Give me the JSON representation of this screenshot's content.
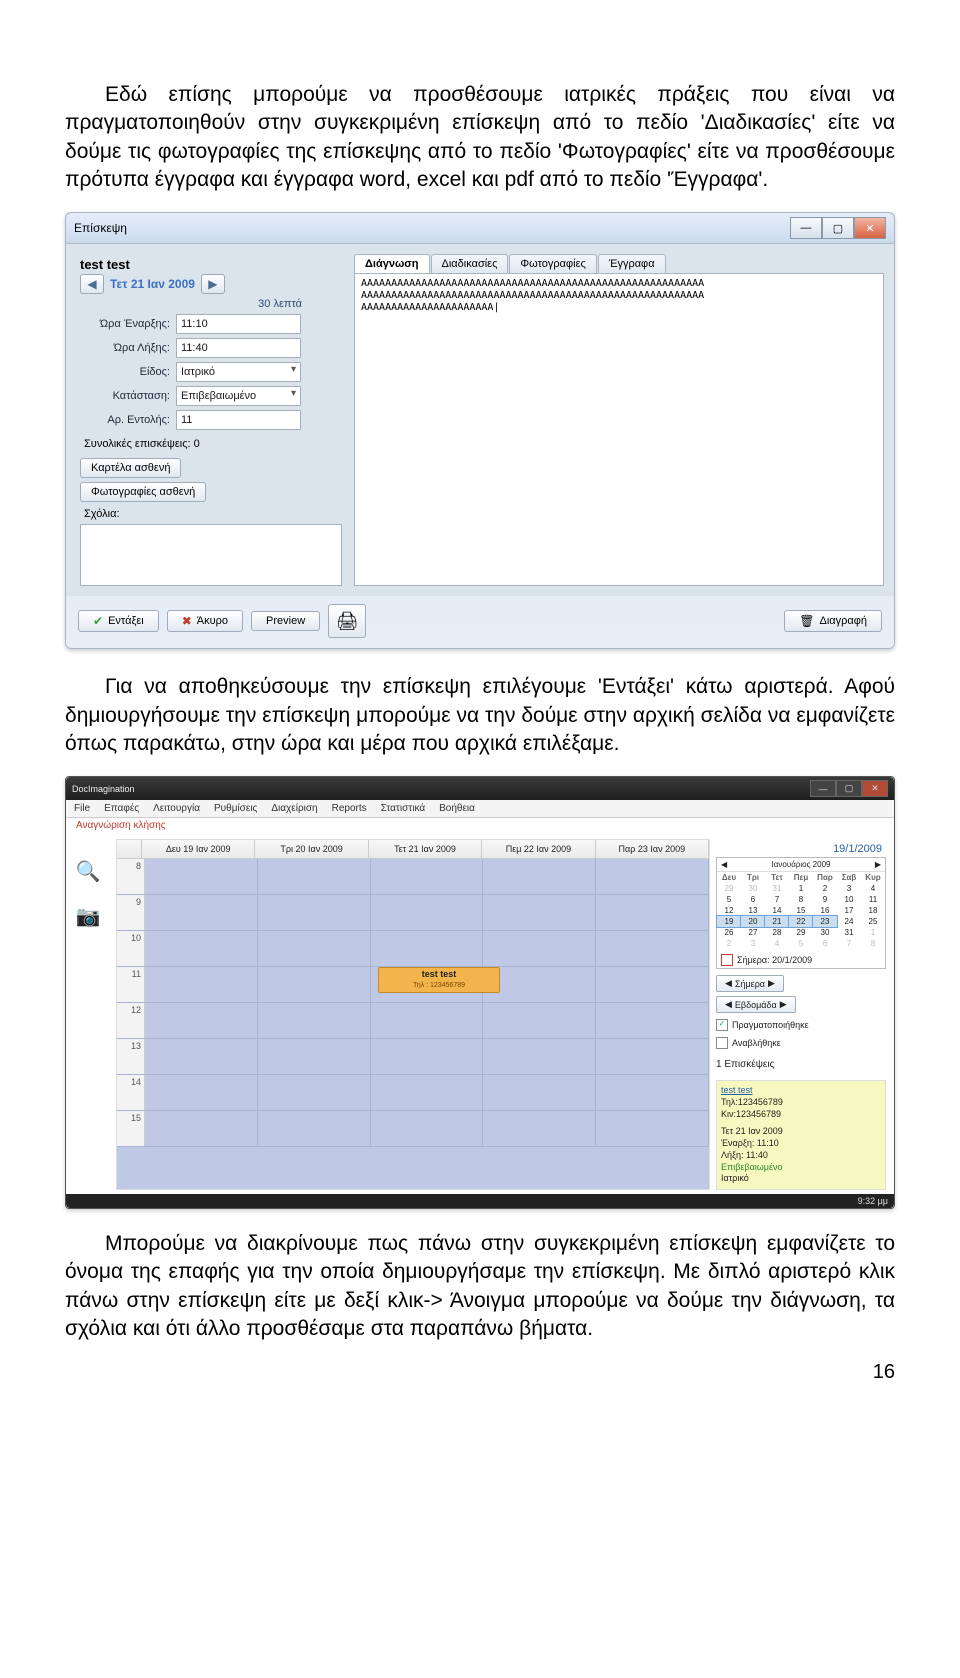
{
  "paragraph1": "Εδώ επίσης μπορούμε να προσθέσουμε ιατρικές πράξεις που είναι να πραγματοποιηθούν στην συγκεκριμένη επίσκεψη από το πεδίο 'Διαδικασίες' είτε να δούμε τις φωτογραφίες της επίσκεψης από το πεδίο 'Φωτογραφίες' είτε να προσθέσουμε πρότυπα έγγραφα και έγγραφα word, excel και pdf από το πεδίο 'Έγγραφα'.",
  "paragraph2": "Για να αποθηκεύσουμε την επίσκεψη επιλέγουμε 'Εντάξει' κάτω αριστερά. Αφού δημιουργήσουμε την επίσκεψη μπορούμε να την δούμε στην αρχική σελίδα να εμφανίζετε όπως παρακάτω, στην ώρα και μέρα που αρχικά επιλέξαμε.",
  "paragraph3": "Μπορούμε να διακρίνουμε πως πάνω στην συγκεκριμένη επίσκεψη εμφανίζετε το όνομα της επαφής για την οποία δημιουργήσαμε την επίσκεψη. Με διπλό αριστερό κλικ πάνω στην επίσκεψη είτε με δεξί κλικ-> Άνοιγμα μπορούμε να δούμε την διάγνωση, τα σχόλια και ότι άλλο προσθέσαμε στα παραπάνω βήματα.",
  "page_number": "16",
  "win1": {
    "title": "Επίσκεψη",
    "patient": "test test",
    "date": "Τετ 21 Ιαν 2009",
    "duration": "30 λεπτά",
    "labels": {
      "start": "Ώρα Έναρξης:",
      "end": "Ώρα Λήξης:",
      "kind": "Είδος:",
      "status": "Κατάσταση:",
      "orderno": "Αρ. Εντολής:",
      "totalvisits": "Συνολικές επισκέψεις: 0",
      "comments": "Σχόλια:"
    },
    "values": {
      "start": "11:10",
      "end": "11:40",
      "kind": "Ιατρικό",
      "status": "Επιβεβαιωμένο",
      "orderno": "11"
    },
    "buttons": {
      "card": "Καρτέλα ασθενή",
      "photos": "Φωτογραφίες ασθενή",
      "ok": "Εντάξει",
      "cancel": "Άκυρο",
      "preview": "Preview",
      "delete": "Διαγραφή"
    },
    "tabs": {
      "diag": "Διάγνωση",
      "proc": "Διαδικασίες",
      "photos": "Φωτογραφίες",
      "docs": "Έγγραφα"
    },
    "diag_body": "ΑΑΑΑΑΑΑΑΑΑΑΑΑΑΑΑΑΑΑΑΑΑΑΑΑΑΑΑΑΑΑΑΑΑΑΑΑΑΑΑΑΑΑΑΑΑΑΑΑΑΑΑΑΑΑΑΑ\nΑΑΑΑΑΑΑΑΑΑΑΑΑΑΑΑΑΑΑΑΑΑΑΑΑΑΑΑΑΑΑΑΑΑΑΑΑΑΑΑΑΑΑΑΑΑΑΑΑΑΑΑΑΑΑΑΑ\nΑΑΑΑΑΑΑΑΑΑΑΑΑΑΑΑΑΑΑΑΑΑ|"
  },
  "win2": {
    "app": "DocImagination",
    "menu": [
      "File",
      "Επαφές",
      "Λειτουργία",
      "Ρυθμίσεις",
      "Διαχείριση",
      "Reports",
      "Στατιστικά",
      "Βοήθεια"
    ],
    "redline": "Αναγνώριση κλήσης",
    "datepicker": "19/1/2009",
    "days": [
      "Δευ 19 Ιαν 2009",
      "Τρι 20 Ιαν 2009",
      "Τετ 21 Ιαν 2009",
      "Πεμ 22 Ιαν 2009",
      "Παρ 23 Ιαν 2009"
    ],
    "hours": [
      "8",
      "9",
      "10",
      "11",
      "12",
      "13",
      "14",
      "15"
    ],
    "appt_name": "test test",
    "appt_tel": "Τηλ : 123456789",
    "minical": {
      "month": "Ιανουάριος 2009",
      "dow": [
        "Δευ",
        "Τρι",
        "Τετ",
        "Πεμ",
        "Παρ",
        "Σαβ",
        "Κυρ"
      ],
      "lead": [
        "29",
        "30",
        "31"
      ],
      "days": [
        "1",
        "2",
        "3",
        "4",
        "5",
        "6",
        "7",
        "8",
        "9",
        "10",
        "11",
        "12",
        "13",
        "14",
        "15",
        "16",
        "17",
        "18",
        "19",
        "20",
        "21",
        "22",
        "23",
        "24",
        "25",
        "26",
        "27",
        "28",
        "29",
        "30",
        "31"
      ],
      "trail": [
        "1",
        "2",
        "3",
        "4",
        "5",
        "6",
        "7",
        "8"
      ],
      "selected_from": 19,
      "selected_to": 23,
      "today_label": "Σήμερα: 20/1/2009"
    },
    "nav": {
      "today": "Σήμερα",
      "week": "Εβδομάδα",
      "done_chk": "Πραγματοποιήθηκε",
      "postponed": "Αναβλήθηκε"
    },
    "right_info": {
      "count": "1 Επισκέψεις",
      "name": "test test",
      "tel": "Τηλ:123456789",
      "mob": "Κιν:123456789",
      "date": "Τετ 21 Ιαν 2009",
      "start": "Έναρξη: 11:10",
      "end": "Λήξη: 11:40",
      "status": "Επιβεβαιωμένο",
      "kind": "Ιατρικό"
    },
    "clock": "9:32 μμ"
  }
}
